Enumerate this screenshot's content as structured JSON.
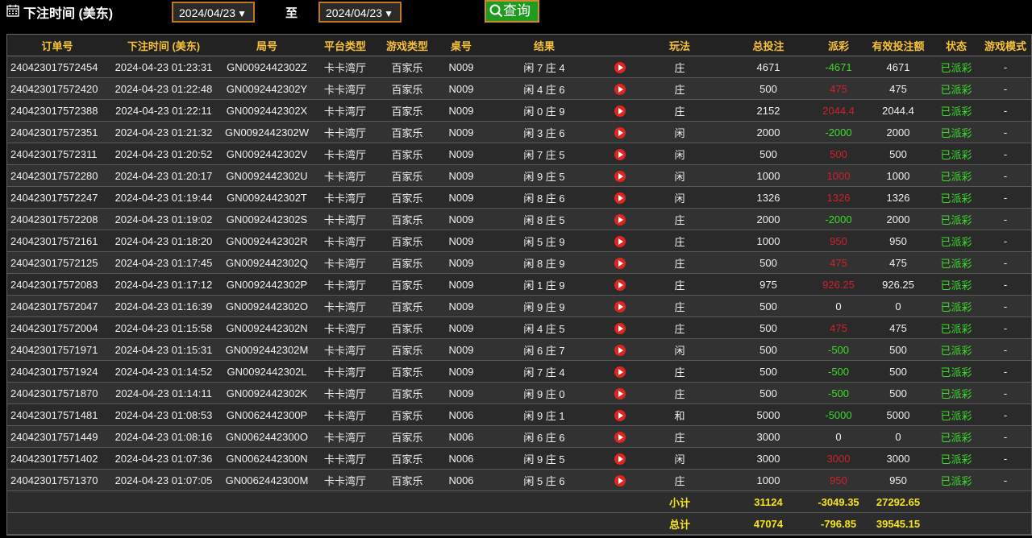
{
  "header": {
    "title": "下注时间 (美东)",
    "date_from": "2024/04/23",
    "to_label": "至",
    "date_to": "2024/04/23",
    "query_label": "查询"
  },
  "table": {
    "columns": [
      "订单号",
      "下注时间 (美东)",
      "局号",
      "平台类型",
      "游戏类型",
      "桌号",
      "结果",
      "",
      "玩法",
      "总投注",
      "派彩",
      "有效投注额",
      "状态",
      "游戏模式"
    ],
    "rows": [
      {
        "order": "240423017572454",
        "time": "2024-04-23 01:23:31",
        "round": "GN0092442302Z",
        "platform": "卡卡湾厅",
        "game": "百家乐",
        "table": "N009",
        "result": "闲 7 庄 4",
        "play": "庄",
        "bet": "4671",
        "payout": "-4671",
        "payout_sign": "neg",
        "valid": "4671",
        "status": "已派彩",
        "mode": "-"
      },
      {
        "order": "240423017572420",
        "time": "2024-04-23 01:22:48",
        "round": "GN0092442302Y",
        "platform": "卡卡湾厅",
        "game": "百家乐",
        "table": "N009",
        "result": "闲 4 庄 6",
        "play": "庄",
        "bet": "500",
        "payout": "475",
        "payout_sign": "pos",
        "valid": "475",
        "status": "已派彩",
        "mode": "-"
      },
      {
        "order": "240423017572388",
        "time": "2024-04-23 01:22:11",
        "round": "GN0092442302X",
        "platform": "卡卡湾厅",
        "game": "百家乐",
        "table": "N009",
        "result": "闲 0 庄 9",
        "play": "庄",
        "bet": "2152",
        "payout": "2044.4",
        "payout_sign": "pos",
        "valid": "2044.4",
        "status": "已派彩",
        "mode": "-"
      },
      {
        "order": "240423017572351",
        "time": "2024-04-23 01:21:32",
        "round": "GN0092442302W",
        "platform": "卡卡湾厅",
        "game": "百家乐",
        "table": "N009",
        "result": "闲 3 庄 6",
        "play": "闲",
        "bet": "2000",
        "payout": "-2000",
        "payout_sign": "neg",
        "valid": "2000",
        "status": "已派彩",
        "mode": "-"
      },
      {
        "order": "240423017572311",
        "time": "2024-04-23 01:20:52",
        "round": "GN0092442302V",
        "platform": "卡卡湾厅",
        "game": "百家乐",
        "table": "N009",
        "result": "闲 7 庄 5",
        "play": "闲",
        "bet": "500",
        "payout": "500",
        "payout_sign": "pos",
        "valid": "500",
        "status": "已派彩",
        "mode": "-"
      },
      {
        "order": "240423017572280",
        "time": "2024-04-23 01:20:17",
        "round": "GN0092442302U",
        "platform": "卡卡湾厅",
        "game": "百家乐",
        "table": "N009",
        "result": "闲 9 庄 5",
        "play": "闲",
        "bet": "1000",
        "payout": "1000",
        "payout_sign": "pos",
        "valid": "1000",
        "status": "已派彩",
        "mode": "-"
      },
      {
        "order": "240423017572247",
        "time": "2024-04-23 01:19:44",
        "round": "GN0092442302T",
        "platform": "卡卡湾厅",
        "game": "百家乐",
        "table": "N009",
        "result": "闲 8 庄 6",
        "play": "闲",
        "bet": "1326",
        "payout": "1326",
        "payout_sign": "pos",
        "valid": "1326",
        "status": "已派彩",
        "mode": "-"
      },
      {
        "order": "240423017572208",
        "time": "2024-04-23 01:19:02",
        "round": "GN0092442302S",
        "platform": "卡卡湾厅",
        "game": "百家乐",
        "table": "N009",
        "result": "闲 8 庄 5",
        "play": "庄",
        "bet": "2000",
        "payout": "-2000",
        "payout_sign": "neg",
        "valid": "2000",
        "status": "已派彩",
        "mode": "-"
      },
      {
        "order": "240423017572161",
        "time": "2024-04-23 01:18:20",
        "round": "GN0092442302R",
        "platform": "卡卡湾厅",
        "game": "百家乐",
        "table": "N009",
        "result": "闲 5 庄 9",
        "play": "庄",
        "bet": "1000",
        "payout": "950",
        "payout_sign": "pos",
        "valid": "950",
        "status": "已派彩",
        "mode": "-"
      },
      {
        "order": "240423017572125",
        "time": "2024-04-23 01:17:45",
        "round": "GN0092442302Q",
        "platform": "卡卡湾厅",
        "game": "百家乐",
        "table": "N009",
        "result": "闲 8 庄 9",
        "play": "庄",
        "bet": "500",
        "payout": "475",
        "payout_sign": "pos",
        "valid": "475",
        "status": "已派彩",
        "mode": "-"
      },
      {
        "order": "240423017572083",
        "time": "2024-04-23 01:17:12",
        "round": "GN0092442302P",
        "platform": "卡卡湾厅",
        "game": "百家乐",
        "table": "N009",
        "result": "闲 1 庄 9",
        "play": "庄",
        "bet": "975",
        "payout": "926.25",
        "payout_sign": "pos",
        "valid": "926.25",
        "status": "已派彩",
        "mode": "-"
      },
      {
        "order": "240423017572047",
        "time": "2024-04-23 01:16:39",
        "round": "GN0092442302O",
        "platform": "卡卡湾厅",
        "game": "百家乐",
        "table": "N009",
        "result": "闲 9 庄 9",
        "play": "庄",
        "bet": "500",
        "payout": "0",
        "payout_sign": "zero",
        "valid": "0",
        "status": "已派彩",
        "mode": "-"
      },
      {
        "order": "240423017572004",
        "time": "2024-04-23 01:15:58",
        "round": "GN0092442302N",
        "platform": "卡卡湾厅",
        "game": "百家乐",
        "table": "N009",
        "result": "闲 4 庄 5",
        "play": "庄",
        "bet": "500",
        "payout": "475",
        "payout_sign": "pos",
        "valid": "475",
        "status": "已派彩",
        "mode": "-"
      },
      {
        "order": "240423017571971",
        "time": "2024-04-23 01:15:31",
        "round": "GN0092442302M",
        "platform": "卡卡湾厅",
        "game": "百家乐",
        "table": "N009",
        "result": "闲 6 庄 7",
        "play": "闲",
        "bet": "500",
        "payout": "-500",
        "payout_sign": "neg",
        "valid": "500",
        "status": "已派彩",
        "mode": "-"
      },
      {
        "order": "240423017571924",
        "time": "2024-04-23 01:14:52",
        "round": "GN0092442302L",
        "platform": "卡卡湾厅",
        "game": "百家乐",
        "table": "N009",
        "result": "闲 7 庄 4",
        "play": "庄",
        "bet": "500",
        "payout": "-500",
        "payout_sign": "neg",
        "valid": "500",
        "status": "已派彩",
        "mode": "-"
      },
      {
        "order": "240423017571870",
        "time": "2024-04-23 01:14:11",
        "round": "GN0092442302K",
        "platform": "卡卡湾厅",
        "game": "百家乐",
        "table": "N009",
        "result": "闲 9 庄 0",
        "play": "庄",
        "bet": "500",
        "payout": "-500",
        "payout_sign": "neg",
        "valid": "500",
        "status": "已派彩",
        "mode": "-"
      },
      {
        "order": "240423017571481",
        "time": "2024-04-23 01:08:53",
        "round": "GN0062442300P",
        "platform": "卡卡湾厅",
        "game": "百家乐",
        "table": "N006",
        "result": "闲 9 庄 1",
        "play": "和",
        "bet": "5000",
        "payout": "-5000",
        "payout_sign": "neg",
        "valid": "5000",
        "status": "已派彩",
        "mode": "-"
      },
      {
        "order": "240423017571449",
        "time": "2024-04-23 01:08:16",
        "round": "GN0062442300O",
        "platform": "卡卡湾厅",
        "game": "百家乐",
        "table": "N006",
        "result": "闲 6 庄 6",
        "play": "庄",
        "bet": "3000",
        "payout": "0",
        "payout_sign": "zero",
        "valid": "0",
        "status": "已派彩",
        "mode": "-"
      },
      {
        "order": "240423017571402",
        "time": "2024-04-23 01:07:36",
        "round": "GN0062442300N",
        "platform": "卡卡湾厅",
        "game": "百家乐",
        "table": "N006",
        "result": "闲 9 庄 5",
        "play": "闲",
        "bet": "3000",
        "payout": "3000",
        "payout_sign": "pos",
        "valid": "3000",
        "status": "已派彩",
        "mode": "-"
      },
      {
        "order": "240423017571370",
        "time": "2024-04-23 01:07:05",
        "round": "GN0062442300M",
        "platform": "卡卡湾厅",
        "game": "百家乐",
        "table": "N006",
        "result": "闲 5 庄 6",
        "play": "庄",
        "bet": "1000",
        "payout": "950",
        "payout_sign": "pos",
        "valid": "950",
        "status": "已派彩",
        "mode": "-"
      }
    ],
    "subtotal": {
      "label": "小计",
      "bet": "31124",
      "payout": "-3049.35",
      "valid": "27292.65"
    },
    "total": {
      "label": "总计",
      "bet": "47074",
      "payout": "-796.85",
      "valid": "39545.15"
    }
  },
  "colors": {
    "header_text": "#f6c23a",
    "payout_negative": "#3bdc2a",
    "payout_positive": "#d0202f",
    "status": "#3bdc2a",
    "summary": "#f6e31c",
    "query_button": "#1f9c1f",
    "date_border": "#c1771f"
  },
  "icons": {
    "calendar": "calendar-icon",
    "search": "search-icon",
    "play": "play-video-icon",
    "dropdown": "caret-down-icon"
  }
}
